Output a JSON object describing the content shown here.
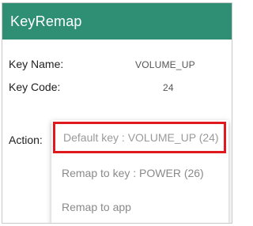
{
  "app_bar": {
    "title": "KeyRemap",
    "color": "#2f8f74"
  },
  "details": {
    "key_name_label": "Key Name:",
    "key_name_value": "VOLUME_UP",
    "key_code_label": "Key Code:",
    "key_code_value": "24"
  },
  "action": {
    "label": "Action:",
    "options": [
      "Default key : VOLUME_UP (24)",
      "Remap to key : POWER (26)",
      "Remap to app"
    ],
    "selected_index": 0,
    "highlight_color": "#e0191f"
  }
}
